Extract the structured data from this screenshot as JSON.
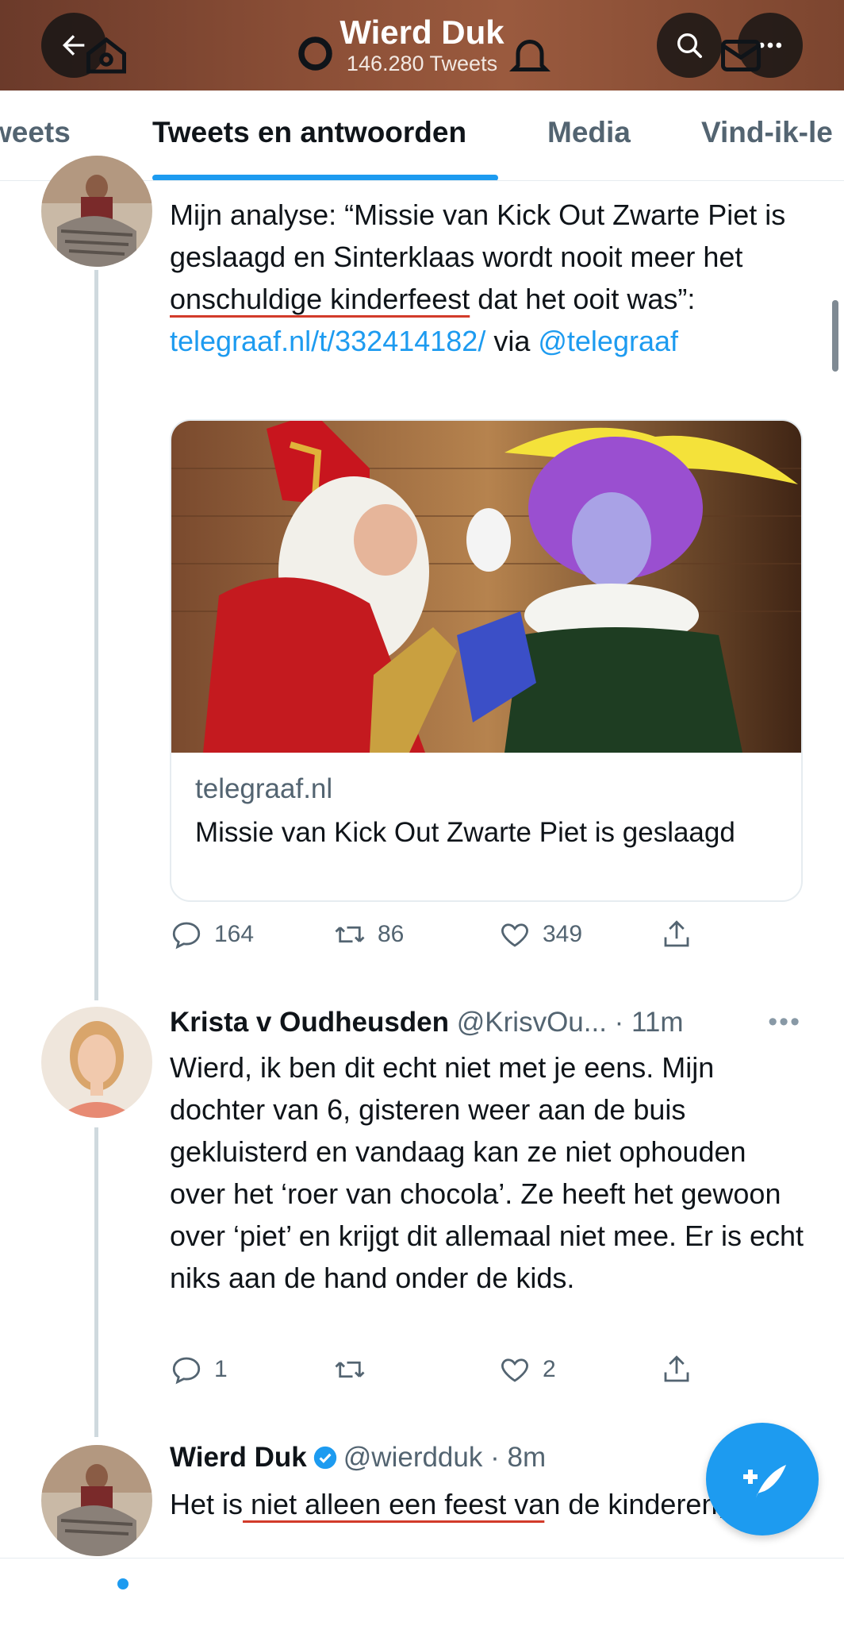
{
  "header": {
    "title": "Wierd Duk",
    "subtitle": "146.280 Tweets",
    "back_icon": "back-arrow-icon",
    "search_icon": "search-icon",
    "more_icon": "more-icon"
  },
  "tabs": [
    {
      "label": "Tweets",
      "shown": "weets"
    },
    {
      "label": "Tweets en antwoorden",
      "active": true
    },
    {
      "label": "Media"
    },
    {
      "label": "Vind-ik-leuks",
      "shown": "Vind-ik-le"
    }
  ],
  "tweet1": {
    "text_part1": "Mijn analyse: “Missie van Kick Out Zwarte Piet is geslaagd en Sinterklaas wordt nooit meer het ",
    "text_underlined": "onschuldige kinderfeest",
    "text_part2": " dat het ooit was”: ",
    "link": "telegraaf.nl/t/332414182/",
    "via": " via ",
    "mention": "@telegraaf",
    "card": {
      "domain": "telegraaf.nl",
      "title": "Missie van Kick Out Zwarte Piet is geslaagd"
    },
    "actions": {
      "replies": "164",
      "retweets": "86",
      "likes": "349"
    }
  },
  "tweet2": {
    "name": "Krista v Oudheusden",
    "handle": "@KrisvOu...",
    "time": "· 11m",
    "more": "•••",
    "text": "Wierd, ik ben dit echt niet met je eens. Mijn dochter van 6, gisteren weer aan de buis gekluisterd en vandaag kan ze niet ophouden over het ‘roer van chocola’. Ze heeft het gewoon over ‘piet’ en krijgt dit allemaal niet mee. Er is echt niks aan de hand onder de kids.",
    "actions": {
      "replies": "1",
      "retweets": "",
      "likes": "2"
    }
  },
  "tweet3": {
    "name": "Wierd Duk",
    "handle": "@wierdduk",
    "time": "· 8m",
    "text_part1": "Het is",
    "text_underlined": " niet alleen een feest va",
    "text_part2": "n de kinderen, toch?"
  },
  "colors": {
    "accent": "#1d9bf0",
    "text": "#0f1419",
    "secondary": "#536471",
    "header_bg": "#8a4e36",
    "annotation_underline": "#d23b2a"
  },
  "bottom_nav": [
    "home-icon",
    "search-icon",
    "notifications-icon",
    "messages-icon"
  ]
}
